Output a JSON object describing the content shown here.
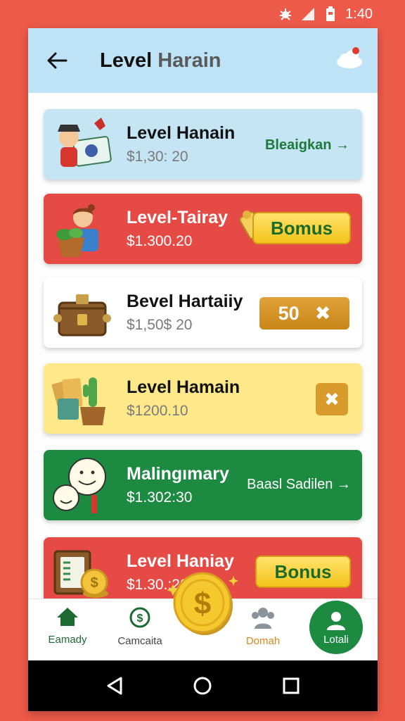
{
  "status_bar": {
    "time": "1:40",
    "icons": [
      "bug-icon",
      "signal-icon",
      "battery-icon"
    ]
  },
  "header": {
    "title_main": "Level",
    "title_secondary": "Harain"
  },
  "cards": [
    {
      "title": "Level Hanain",
      "amount": "$1,30: 20",
      "action": "Bleaigkan",
      "action_arrow": "→",
      "bg": "#c5e5f5"
    },
    {
      "title": "Level-Tairay",
      "amount": "$1.300.20",
      "action": "Bomus",
      "bg": "#e64a45"
    },
    {
      "title": "Bevel Hartaiiy",
      "amount": "$1,50$ 20",
      "action": "50",
      "action_icon": "✖",
      "bg": "#ffffff"
    },
    {
      "title": "Level Hamain",
      "amount": "$1200.10",
      "action_icon": "✖",
      "bg": "#fde98a"
    },
    {
      "title": "Malingımary",
      "amount": "$1.302:30",
      "action": "Baasl Sadilen",
      "action_arrow": "→",
      "bg": "#1d8a42"
    },
    {
      "title": "Level Haniay",
      "amount": "$1.30.:20",
      "action": "Bonus",
      "bg": "#e64a45"
    }
  ],
  "bottom_nav": [
    {
      "label": "Eamady",
      "icon": "home-icon"
    },
    {
      "label": "Camcaita",
      "icon": "dollar-circle-icon"
    },
    {
      "label": "Domah",
      "icon": "people-icon"
    },
    {
      "label": "Lotali",
      "icon": "user-icon"
    }
  ],
  "colors": {
    "accent_green": "#1d8a42",
    "accent_red": "#e64a45",
    "bonus_yellow": "#f5c41c"
  }
}
